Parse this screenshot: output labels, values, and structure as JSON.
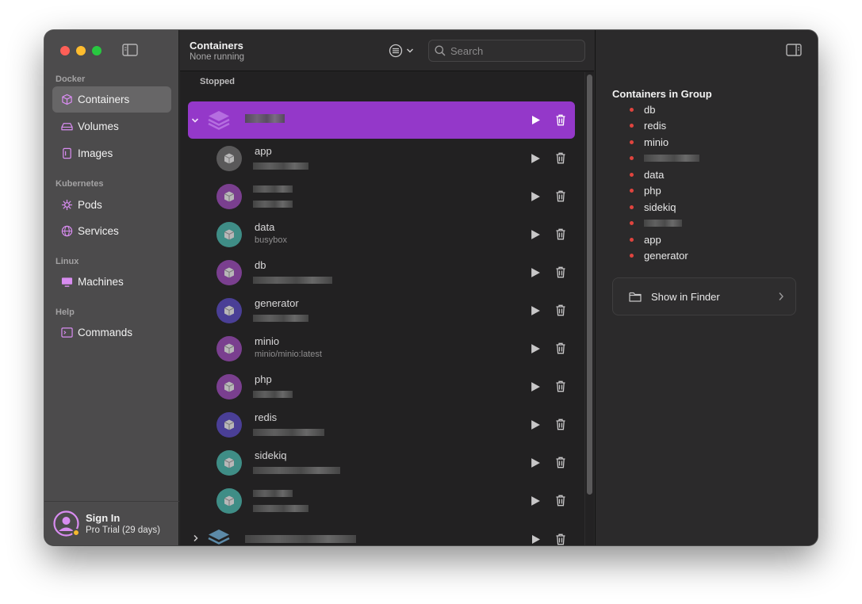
{
  "sidebar": {
    "sections": [
      {
        "label": "Docker",
        "items": [
          {
            "label": "Containers",
            "icon": "cube-icon",
            "active": true
          },
          {
            "label": "Volumes",
            "icon": "drive-icon"
          },
          {
            "label": "Images",
            "icon": "image-icon"
          }
        ]
      },
      {
        "label": "Kubernetes",
        "items": [
          {
            "label": "Pods",
            "icon": "helm-icon"
          },
          {
            "label": "Services",
            "icon": "globe-icon"
          }
        ]
      },
      {
        "label": "Linux",
        "items": [
          {
            "label": "Machines",
            "icon": "monitor-icon"
          }
        ]
      },
      {
        "label": "Help",
        "items": [
          {
            "label": "Commands",
            "icon": "terminal-icon"
          }
        ]
      }
    ],
    "signin": {
      "title": "Sign In",
      "subtitle": "Pro Trial (29 days)"
    }
  },
  "list": {
    "title": "Containers",
    "subtitle": "None running",
    "search_placeholder": "Search",
    "section_label": "Stopped",
    "containers": [
      {
        "name": "app",
        "image": "",
        "color": "#5a595a"
      },
      {
        "name": "",
        "image": "",
        "color": "#7a3f8f"
      },
      {
        "name": "data",
        "image": "busybox",
        "color": "#3f8d86"
      },
      {
        "name": "db",
        "image": "",
        "color": "#7a3f8f"
      },
      {
        "name": "generator",
        "image": "",
        "color": "#4a3f96"
      },
      {
        "name": "minio",
        "image": "minio/minio:latest",
        "color": "#7a3f8f"
      },
      {
        "name": "php",
        "image": "",
        "color": "#7a3f8f"
      },
      {
        "name": "redis",
        "image": "",
        "color": "#4a3f96"
      },
      {
        "name": "sidekiq",
        "image": "",
        "color": "#3f8d86"
      },
      {
        "name": "",
        "image": "",
        "color": "#3f8d86"
      }
    ]
  },
  "inspector": {
    "title": "Containers in Group",
    "items": [
      "db",
      "redis",
      "minio",
      "",
      "data",
      "php",
      "sidekiq",
      "",
      "app",
      "generator"
    ],
    "finder_label": "Show in Finder"
  },
  "colors": {
    "accent": "#9438c9",
    "bullet": "#e0443e"
  }
}
